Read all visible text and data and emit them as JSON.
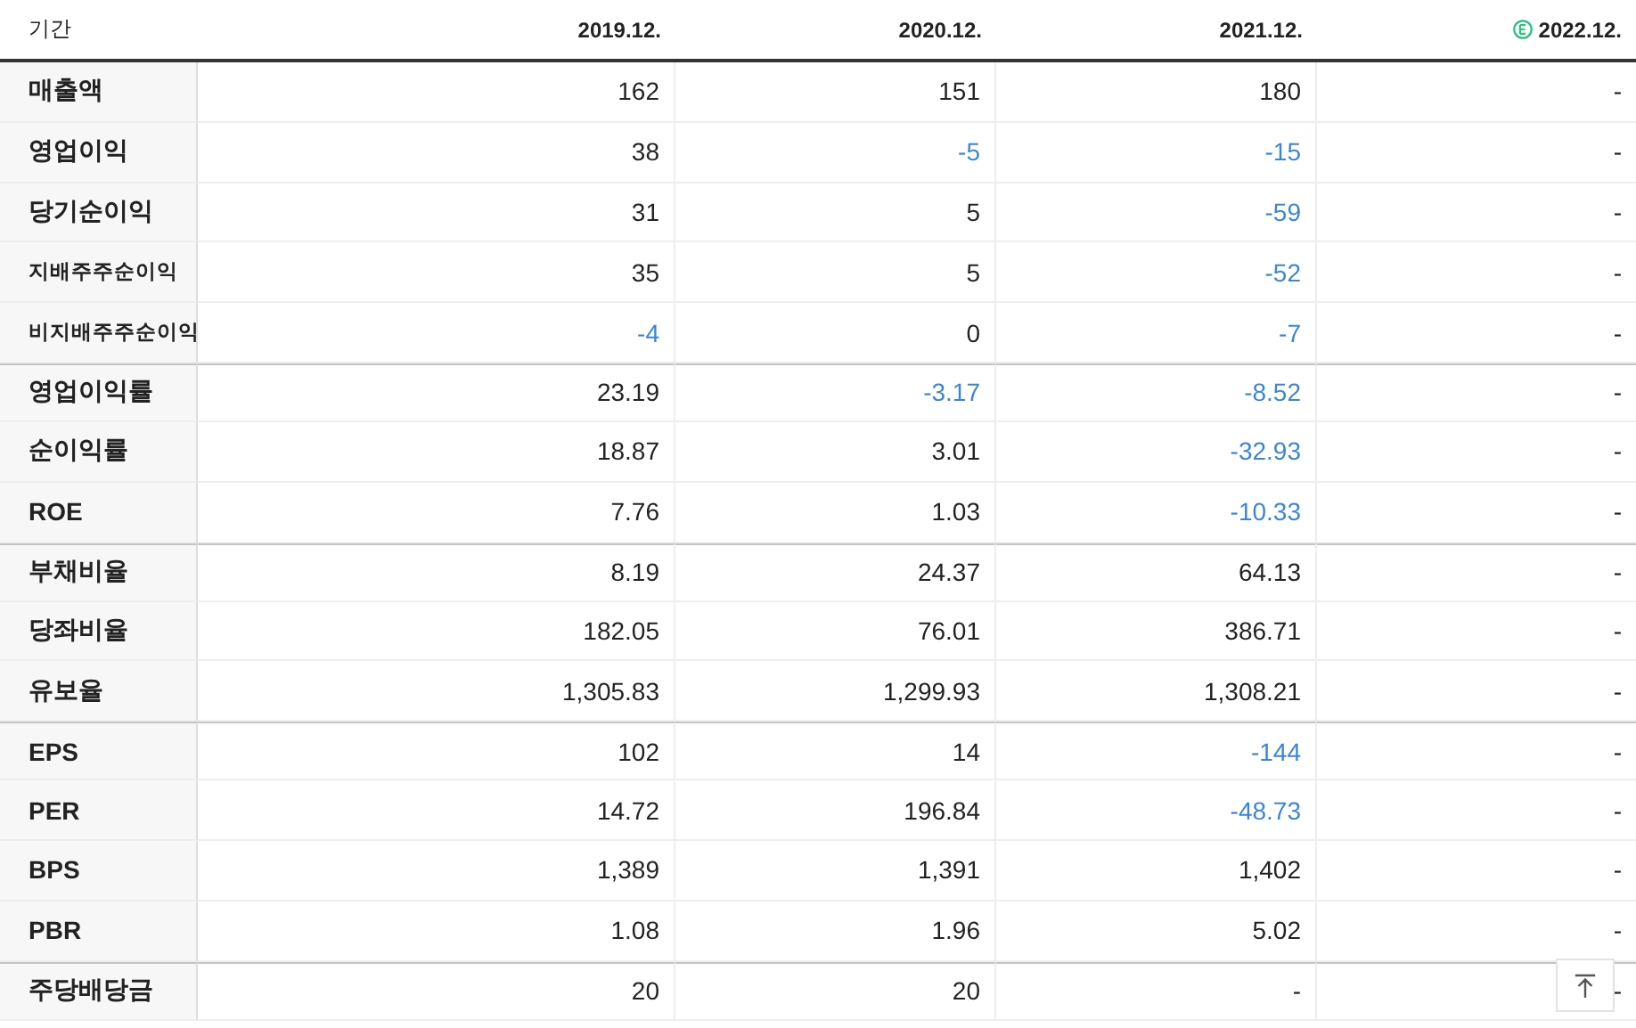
{
  "table": {
    "columns": [
      {
        "label": "기간",
        "estimate": false
      },
      {
        "label": "2019.12.",
        "estimate": false
      },
      {
        "label": "2020.12.",
        "estimate": false
      },
      {
        "label": "2021.12.",
        "estimate": false
      },
      {
        "label": "2022.12.",
        "estimate": true
      }
    ],
    "rows": [
      {
        "kind": "main",
        "group_start": false,
        "cells": [
          {
            "text": "매출액",
            "negative": false
          },
          {
            "text": "162",
            "negative": false
          },
          {
            "text": "151",
            "negative": false
          },
          {
            "text": "180",
            "negative": false
          },
          {
            "text": "-",
            "negative": false
          }
        ]
      },
      {
        "kind": "main",
        "group_start": false,
        "cells": [
          {
            "text": "영업이익",
            "negative": false
          },
          {
            "text": "38",
            "negative": false
          },
          {
            "text": "-5",
            "negative": true
          },
          {
            "text": "-15",
            "negative": true
          },
          {
            "text": "-",
            "negative": false
          }
        ]
      },
      {
        "kind": "main",
        "group_start": false,
        "cells": [
          {
            "text": "당기순이익",
            "negative": false
          },
          {
            "text": "31",
            "negative": false
          },
          {
            "text": "5",
            "negative": false
          },
          {
            "text": "-59",
            "negative": true
          },
          {
            "text": "-",
            "negative": false
          }
        ]
      },
      {
        "kind": "sub",
        "group_start": false,
        "cells": [
          {
            "text": "지배주주순이익",
            "negative": false
          },
          {
            "text": "35",
            "negative": false
          },
          {
            "text": "5",
            "negative": false
          },
          {
            "text": "-52",
            "negative": true
          },
          {
            "text": "-",
            "negative": false
          }
        ]
      },
      {
        "kind": "sub",
        "group_start": false,
        "cells": [
          {
            "text": "비지배주주순이익",
            "negative": false
          },
          {
            "text": "-4",
            "negative": true
          },
          {
            "text": "0",
            "negative": false
          },
          {
            "text": "-7",
            "negative": true
          },
          {
            "text": "-",
            "negative": false
          }
        ]
      },
      {
        "kind": "main",
        "group_start": true,
        "cells": [
          {
            "text": "영업이익률",
            "negative": false
          },
          {
            "text": "23.19",
            "negative": false
          },
          {
            "text": "-3.17",
            "negative": true
          },
          {
            "text": "-8.52",
            "negative": true
          },
          {
            "text": "-",
            "negative": false
          }
        ]
      },
      {
        "kind": "main",
        "group_start": false,
        "cells": [
          {
            "text": "순이익률",
            "negative": false
          },
          {
            "text": "18.87",
            "negative": false
          },
          {
            "text": "3.01",
            "negative": false
          },
          {
            "text": "-32.93",
            "negative": true
          },
          {
            "text": "-",
            "negative": false
          }
        ]
      },
      {
        "kind": "main",
        "group_start": false,
        "cells": [
          {
            "text": "ROE",
            "negative": false
          },
          {
            "text": "7.76",
            "negative": false
          },
          {
            "text": "1.03",
            "negative": false
          },
          {
            "text": "-10.33",
            "negative": true
          },
          {
            "text": "-",
            "negative": false
          }
        ]
      },
      {
        "kind": "main",
        "group_start": true,
        "cells": [
          {
            "text": "부채비율",
            "negative": false
          },
          {
            "text": "8.19",
            "negative": false
          },
          {
            "text": "24.37",
            "negative": false
          },
          {
            "text": "64.13",
            "negative": false
          },
          {
            "text": "-",
            "negative": false
          }
        ]
      },
      {
        "kind": "main",
        "group_start": false,
        "cells": [
          {
            "text": "당좌비율",
            "negative": false
          },
          {
            "text": "182.05",
            "negative": false
          },
          {
            "text": "76.01",
            "negative": false
          },
          {
            "text": "386.71",
            "negative": false
          },
          {
            "text": "-",
            "negative": false
          }
        ]
      },
      {
        "kind": "main",
        "group_start": false,
        "cells": [
          {
            "text": "유보율",
            "negative": false
          },
          {
            "text": "1,305.83",
            "negative": false
          },
          {
            "text": "1,299.93",
            "negative": false
          },
          {
            "text": "1,308.21",
            "negative": false
          },
          {
            "text": "-",
            "negative": false
          }
        ]
      },
      {
        "kind": "main",
        "group_start": true,
        "cells": [
          {
            "text": "EPS",
            "negative": false
          },
          {
            "text": "102",
            "negative": false
          },
          {
            "text": "14",
            "negative": false
          },
          {
            "text": "-144",
            "negative": true
          },
          {
            "text": "-",
            "negative": false
          }
        ]
      },
      {
        "kind": "main",
        "group_start": false,
        "cells": [
          {
            "text": "PER",
            "negative": false
          },
          {
            "text": "14.72",
            "negative": false
          },
          {
            "text": "196.84",
            "negative": false
          },
          {
            "text": "-48.73",
            "negative": true
          },
          {
            "text": "-",
            "negative": false
          }
        ]
      },
      {
        "kind": "main",
        "group_start": false,
        "cells": [
          {
            "text": "BPS",
            "negative": false
          },
          {
            "text": "1,389",
            "negative": false
          },
          {
            "text": "1,391",
            "negative": false
          },
          {
            "text": "1,402",
            "negative": false
          },
          {
            "text": "-",
            "negative": false
          }
        ]
      },
      {
        "kind": "main",
        "group_start": false,
        "cells": [
          {
            "text": "PBR",
            "negative": false
          },
          {
            "text": "1.08",
            "negative": false
          },
          {
            "text": "1.96",
            "negative": false
          },
          {
            "text": "5.02",
            "negative": false
          },
          {
            "text": "-",
            "negative": false
          }
        ]
      },
      {
        "kind": "main",
        "group_start": true,
        "cells": [
          {
            "text": "주당배당금",
            "negative": false
          },
          {
            "text": "20",
            "negative": false
          },
          {
            "text": "20",
            "negative": false
          },
          {
            "text": "-",
            "negative": false
          },
          {
            "text": "-",
            "negative": false
          }
        ]
      }
    ]
  }
}
